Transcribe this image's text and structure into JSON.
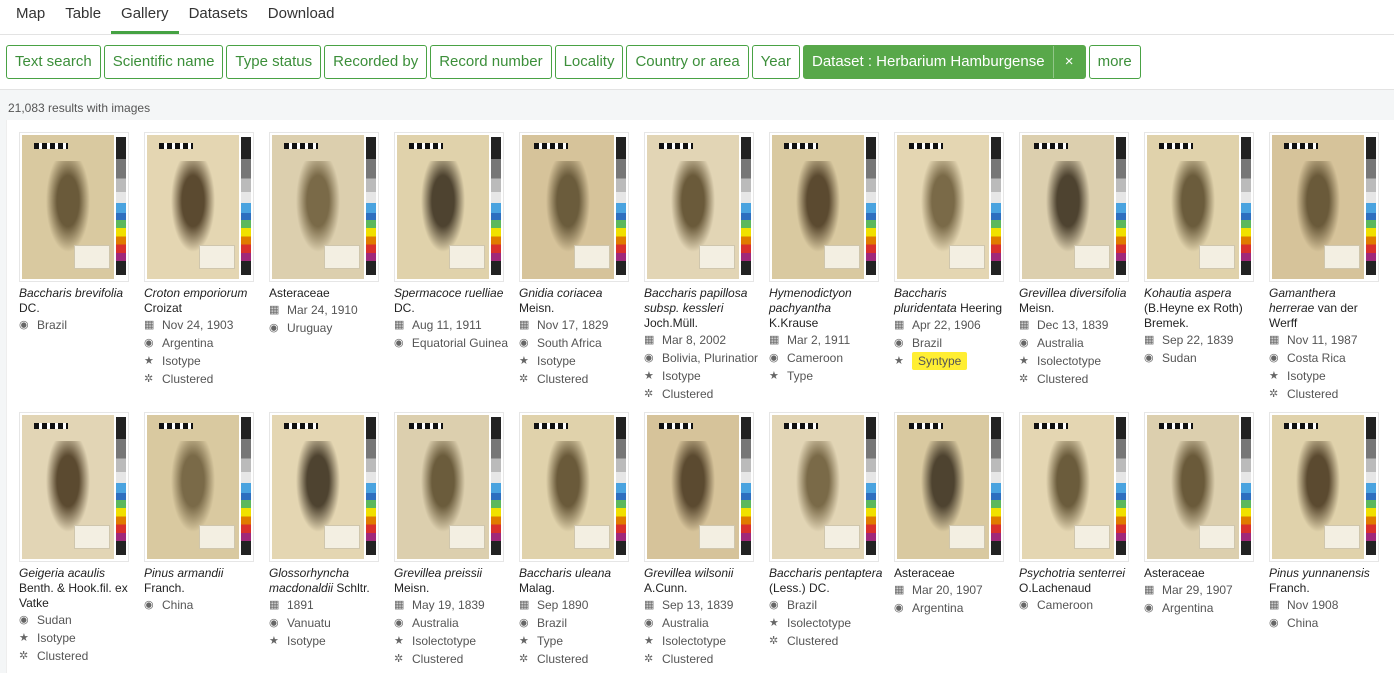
{
  "tabs": [
    "Map",
    "Table",
    "Gallery",
    "Datasets",
    "Download"
  ],
  "active_tab": "Gallery",
  "filters": [
    "Text search",
    "Scientific name",
    "Type status",
    "Recorded by",
    "Record number",
    "Locality",
    "Country or area",
    "Year"
  ],
  "active_filter": {
    "label": "Dataset : Herbarium Hamburgense",
    "close": "×"
  },
  "more_label": "more",
  "results_text": "21,083 results with images",
  "icons": {
    "date": "calendar-icon",
    "country": "globe-icon",
    "type": "star-icon",
    "cluster": "cluster-icon"
  },
  "colors": {
    "accent": "#45a243",
    "highlight": "#ffee33"
  },
  "cards": [
    {
      "name_it": "Baccharis brevifolia",
      "name_auth": "DC.",
      "date": "",
      "country": "Brazil",
      "type": "",
      "cluster": ""
    },
    {
      "name_it": "Croton emporiorum",
      "name_auth": "Croizat",
      "date": "Nov 24, 1903",
      "country": "Argentina",
      "type": "Isotype",
      "cluster": "Clustered"
    },
    {
      "name_it": "",
      "name_auth": "Asteraceae",
      "date": "Mar 24, 1910",
      "country": "Uruguay",
      "type": "",
      "cluster": ""
    },
    {
      "name_it": "Spermacoce ruelliae",
      "name_auth": "DC.",
      "date": "Aug 11, 1911",
      "country": "Equatorial Guinea",
      "type": "",
      "cluster": ""
    },
    {
      "name_it": "Gnidia coriacea",
      "name_auth": "Meisn.",
      "date": "Nov 17, 1829",
      "country": "South Africa",
      "type": "Isotype",
      "cluster": "Clustered"
    },
    {
      "name_it": "Baccharis papillosa subsp. kessleri",
      "name_auth": "Joch.Müll.",
      "date": "Mar 8, 2002",
      "country": "Bolivia, Plurinatior",
      "type": "Isotype",
      "cluster": "Clustered"
    },
    {
      "name_it": "Hymenodictyon pachyantha",
      "name_auth": "K.Krause",
      "date": "Mar 2, 1911",
      "country": "Cameroon",
      "type": "Type",
      "cluster": ""
    },
    {
      "name_it": "Baccharis pluridentata",
      "name_auth": "Heering",
      "date": "Apr 22, 1906",
      "country": "Brazil",
      "type": "Syntype",
      "cluster": "",
      "highlight": true
    },
    {
      "name_it": "Grevillea diversifolia",
      "name_auth": "Meisn.",
      "date": "Dec 13, 1839",
      "country": "Australia",
      "type": "Isolectotype",
      "cluster": "Clustered"
    },
    {
      "name_it": "Kohautia aspera",
      "name_auth": "(B.Heyne ex Roth) Bremek.",
      "date": "Sep 22, 1839",
      "country": "Sudan",
      "type": "",
      "cluster": ""
    },
    {
      "name_it": "Gamanthera herrerae",
      "name_auth": "van der Werff",
      "date": "Nov 11, 1987",
      "country": "Costa Rica",
      "type": "Isotype",
      "cluster": "Clustered"
    },
    {
      "name_it": "Geigeria acaulis",
      "name_auth": "Benth. & Hook.fil. ex Vatke",
      "date": "",
      "country": "Sudan",
      "type": "Isotype",
      "cluster": "Clustered"
    },
    {
      "name_it": "Pinus armandii",
      "name_auth": "Franch.",
      "date": "",
      "country": "China",
      "type": "",
      "cluster": ""
    },
    {
      "name_it": "Glossorhyncha macdonaldii",
      "name_auth": "Schltr.",
      "date": "1891",
      "country": "Vanuatu",
      "type": "Isotype",
      "cluster": ""
    },
    {
      "name_it": "Grevillea preissii",
      "name_auth": "Meisn.",
      "date": "May 19, 1839",
      "country": "Australia",
      "type": "Isolectotype",
      "cluster": "Clustered"
    },
    {
      "name_it": "Baccharis uleana",
      "name_auth": "Malag.",
      "date": "Sep 1890",
      "country": "Brazil",
      "type": "Type",
      "cluster": "Clustered"
    },
    {
      "name_it": "Grevillea wilsonii",
      "name_auth": "A.Cunn.",
      "date": "Sep 13, 1839",
      "country": "Australia",
      "type": "Isolectotype",
      "cluster": "Clustered"
    },
    {
      "name_it": "Baccharis pentaptera",
      "name_auth": "(Less.) DC.",
      "date": "",
      "country": "Brazil",
      "type": "Isolectotype",
      "cluster": "Clustered"
    },
    {
      "name_it": "",
      "name_auth": "Asteraceae",
      "date": "Mar 20, 1907",
      "country": "Argentina",
      "type": "",
      "cluster": ""
    },
    {
      "name_it": "Psychotria senterrei",
      "name_auth": "O.Lachenaud",
      "date": "",
      "country": "Cameroon",
      "type": "",
      "cluster": ""
    },
    {
      "name_it": "",
      "name_auth": "Asteraceae",
      "date": "Mar 29, 1907",
      "country": "Argentina",
      "type": "",
      "cluster": ""
    },
    {
      "name_it": "Pinus yunnanensis",
      "name_auth": "Franch.",
      "date": "Nov 1908",
      "country": "China",
      "type": "",
      "cluster": ""
    }
  ]
}
